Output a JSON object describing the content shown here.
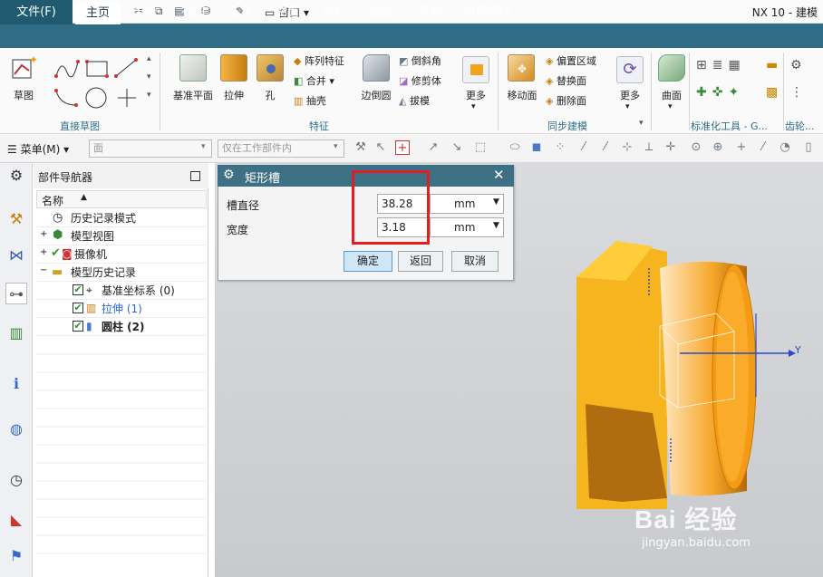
{
  "app": {
    "logo": "NX",
    "title": "NX 10 - 建模",
    "window_menu": "窗口"
  },
  "tabs": [
    "文件(F)",
    "主页",
    "分析",
    "视图",
    "工具",
    "曲面",
    "装配",
    "曲线",
    "渲染",
    "应用模块"
  ],
  "ribbon": {
    "sketch": "草图",
    "datum_plane": "基准平面",
    "extrude": "拉伸",
    "hole": "孔",
    "pattern_feature": "阵列特征",
    "unite": "合并",
    "shell": "抽壳",
    "edge_blend": "边倒圆",
    "chamfer": "倒斜角",
    "trim_body": "修剪体",
    "draft": "拔模",
    "more": "更多",
    "move_face": "移动面",
    "offset_region": "偏置区域",
    "replace_face": "替换面",
    "delete_face": "删除面",
    "more2": "更多",
    "surface": "曲面",
    "groups": {
      "direct_sketch": "直接草图",
      "feature": "特征",
      "sync_modeling": "同步建模",
      "standard_tools": "标准化工具 - G...",
      "gear": "齿轮..."
    }
  },
  "toolbar2": {
    "menu": "菜单(M)",
    "filter_face": "面",
    "filter_scope": "仅在工作部件内"
  },
  "navigator": {
    "title": "部件导航器",
    "col_name": "名称",
    "items": [
      {
        "label": "历史记录模式"
      },
      {
        "label": "模型视图"
      },
      {
        "label": "摄像机"
      },
      {
        "label": "模型历史记录"
      },
      {
        "label": "基准坐标系 (0)"
      },
      {
        "label": "拉伸 (1)"
      },
      {
        "label": "圆柱 (2)"
      }
    ]
  },
  "dialog": {
    "title": "矩形槽",
    "groove_diameter_label": "槽直径",
    "groove_diameter_value": "38.28",
    "width_label": "宽度",
    "width_value": "3.18",
    "unit": "mm",
    "ok": "确定",
    "back": "返回",
    "cancel": "取消"
  },
  "viewport": {
    "axis_y": "Y",
    "watermark": "Bai 经验",
    "watermark_url": "jingyan.baidu.com"
  },
  "colors": {
    "tabbar": "#2f6d86",
    "dialog_head": "#3d7084",
    "highlight_box": "#e02020",
    "part_orange": "#f2a41e"
  }
}
